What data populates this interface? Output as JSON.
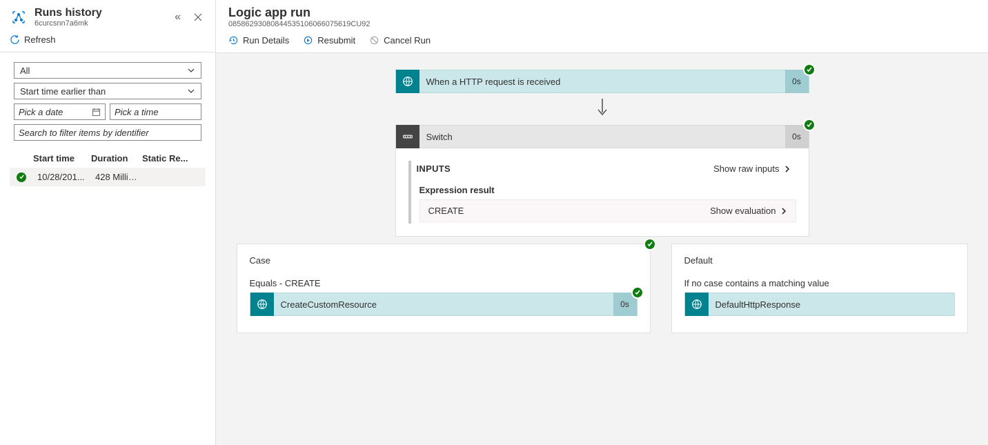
{
  "sidebar": {
    "title": "Runs history",
    "subtitle": "6curcsnn7a6mk",
    "refresh": "Refresh",
    "filter_status": "All",
    "filter_time": "Start time earlier than",
    "date_placeholder": "Pick a date",
    "time_placeholder": "Pick a time",
    "search_placeholder": "Search to filter items by identifier",
    "cols": {
      "start": "Start time",
      "duration": "Duration",
      "static": "Static Re..."
    },
    "rows": [
      {
        "start": "10/28/201...",
        "duration": "428 Millis..."
      }
    ]
  },
  "main": {
    "title": "Logic app run",
    "run_id": "08586293080844535106066075619CU92",
    "toolbar": {
      "details": "Run Details",
      "resubmit": "Resubmit",
      "cancel": "Cancel Run"
    },
    "step1": {
      "label": "When a HTTP request is received",
      "time": "0s"
    },
    "switch": {
      "label": "Switch",
      "time": "0s",
      "inputs": "INPUTS",
      "show_raw": "Show raw inputs",
      "expr_label": "Expression result",
      "expr_value": "CREATE",
      "show_eval": "Show evaluation"
    },
    "case": {
      "title": "Case",
      "subtitle": "Equals - CREATE",
      "step": {
        "label": "CreateCustomResource",
        "time": "0s"
      }
    },
    "default": {
      "title": "Default",
      "subtitle": "If no case contains a matching value",
      "step": {
        "label": "DefaultHttpResponse"
      }
    }
  }
}
